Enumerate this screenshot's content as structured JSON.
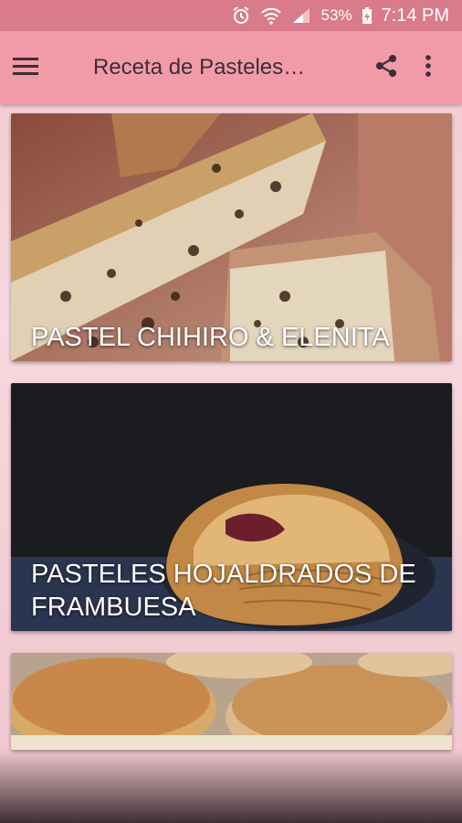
{
  "status": {
    "battery": "53%",
    "time": "7:14 PM"
  },
  "appbar": {
    "title": "Receta de Pasteles…",
    "menu_icon": "hamburger-icon",
    "share_icon": "share-icon",
    "overflow_icon": "more-vert-icon"
  },
  "cards": [
    {
      "caption": "PASTEL CHIHIRO & ELENITA"
    },
    {
      "caption": "PASTELES HOJALDRADOS DE FRAMBUESA"
    },
    {
      "caption": ""
    }
  ],
  "colors": {
    "statusbar": "#d97b8b",
    "appbar": "#f19aa8",
    "background": "#f7d9de"
  }
}
